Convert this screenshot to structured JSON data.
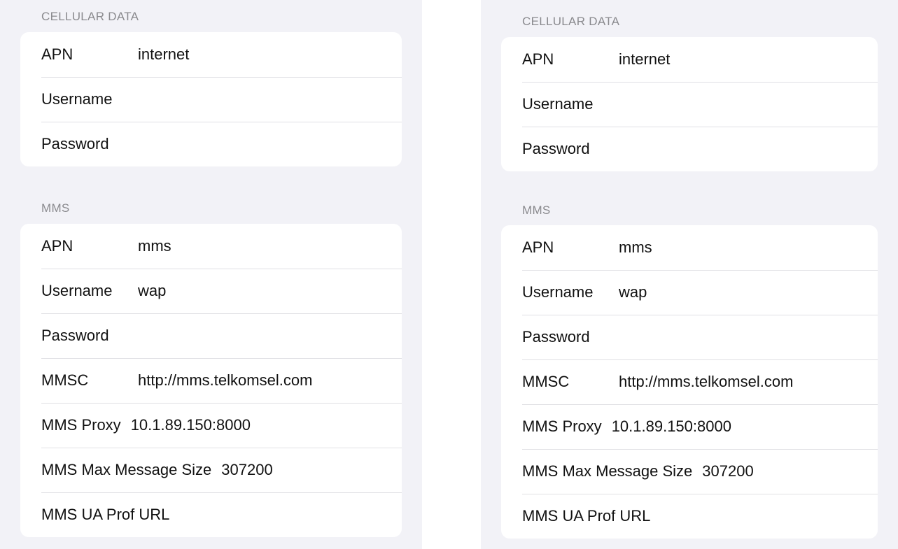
{
  "left": {
    "cellular": {
      "header": "CELLULAR DATA",
      "rows": [
        {
          "label": "APN",
          "value": "internet"
        },
        {
          "label": "Username",
          "value": ""
        },
        {
          "label": "Password",
          "value": ""
        }
      ]
    },
    "mms": {
      "header": "MMS",
      "rows": [
        {
          "label": "APN",
          "value": "mms"
        },
        {
          "label": "Username",
          "value": "wap"
        },
        {
          "label": "Password",
          "value": ""
        },
        {
          "label": "MMSC",
          "value": "http://mms.telkomsel.com"
        },
        {
          "label": "MMS Proxy",
          "value": "10.1.89.150:8000"
        },
        {
          "label": "MMS Max Message Size",
          "value": "307200"
        },
        {
          "label": "MMS UA Prof URL",
          "value": ""
        }
      ]
    }
  },
  "right": {
    "cellular": {
      "header": "CELLULAR DATA",
      "rows": [
        {
          "label": "APN",
          "value": "internet"
        },
        {
          "label": "Username",
          "value": ""
        },
        {
          "label": "Password",
          "value": ""
        }
      ]
    },
    "mms": {
      "header": "MMS",
      "rows": [
        {
          "label": "APN",
          "value": "mms"
        },
        {
          "label": "Username",
          "value": "wap"
        },
        {
          "label": "Password",
          "value": ""
        },
        {
          "label": "MMSC",
          "value": "http://mms.telkomsel.com"
        },
        {
          "label": "MMS Proxy",
          "value": "10.1.89.150:8000"
        },
        {
          "label": "MMS Max Message Size",
          "value": "307200"
        },
        {
          "label": "MMS UA Prof URL",
          "value": ""
        }
      ]
    }
  }
}
